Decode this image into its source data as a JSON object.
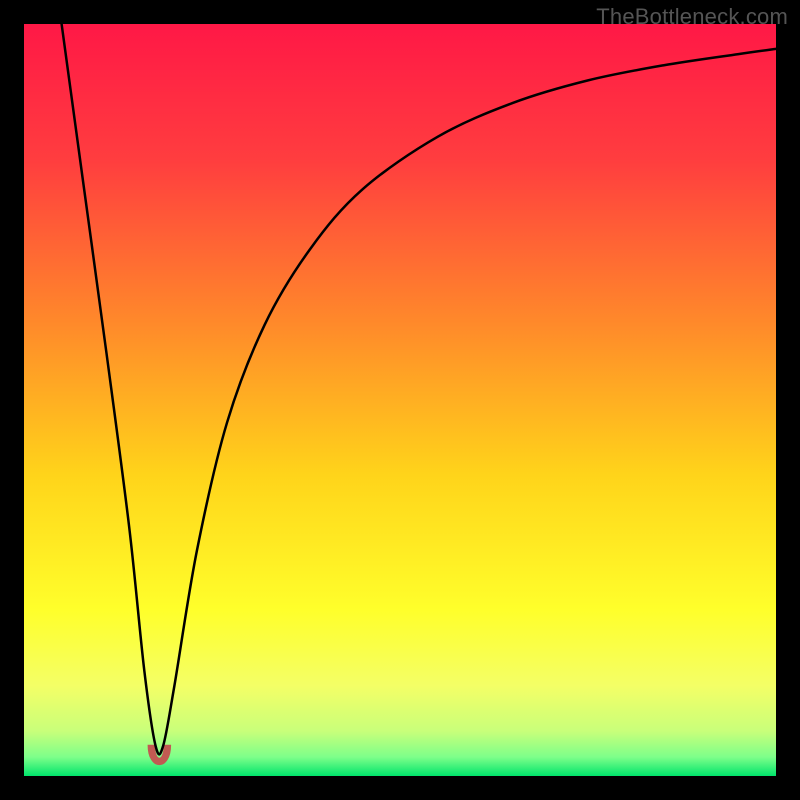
{
  "watermark": {
    "text": "TheBottleneck.com"
  },
  "chart_data": {
    "type": "line",
    "title": "",
    "xlabel": "",
    "ylabel": "",
    "xlim": [
      0,
      100
    ],
    "ylim": [
      0,
      100
    ],
    "grid": false,
    "legend": false,
    "background": {
      "type": "vertical-gradient",
      "description": "red at top through orange/yellow to green at bottom; thin bright green band at very bottom",
      "stops": [
        {
          "pos": 0.0,
          "color": "#ff1846"
        },
        {
          "pos": 0.18,
          "color": "#ff3d3f"
        },
        {
          "pos": 0.4,
          "color": "#ff8a2a"
        },
        {
          "pos": 0.6,
          "color": "#ffd41a"
        },
        {
          "pos": 0.78,
          "color": "#ffff2b"
        },
        {
          "pos": 0.88,
          "color": "#f4ff66"
        },
        {
          "pos": 0.94,
          "color": "#c9ff7a"
        },
        {
          "pos": 0.975,
          "color": "#7dff8a"
        },
        {
          "pos": 1.0,
          "color": "#00e46b"
        }
      ]
    },
    "series": [
      {
        "name": "bottleneck-curve",
        "color": "#000000",
        "stroke_width": 2.5,
        "description": "V-shaped curve: near-vertical descent from top-left, minimum near x≈18, then rising concave curve toward upper-right",
        "x": [
          5,
          8,
          11,
          14,
          16,
          17.5,
          18.5,
          20,
          23,
          27,
          32,
          38,
          45,
          55,
          65,
          75,
          85,
          95,
          100
        ],
        "y": [
          100,
          78,
          56,
          33,
          14,
          4,
          4,
          12,
          30,
          47,
          60,
          70,
          78,
          85,
          89.5,
          92.5,
          94.5,
          96,
          96.7
        ]
      }
    ],
    "annotations": [
      {
        "name": "min-marker",
        "shape": "u-blob",
        "color": "#c15a52",
        "x": 18,
        "y": 2,
        "size": 18
      }
    ]
  }
}
